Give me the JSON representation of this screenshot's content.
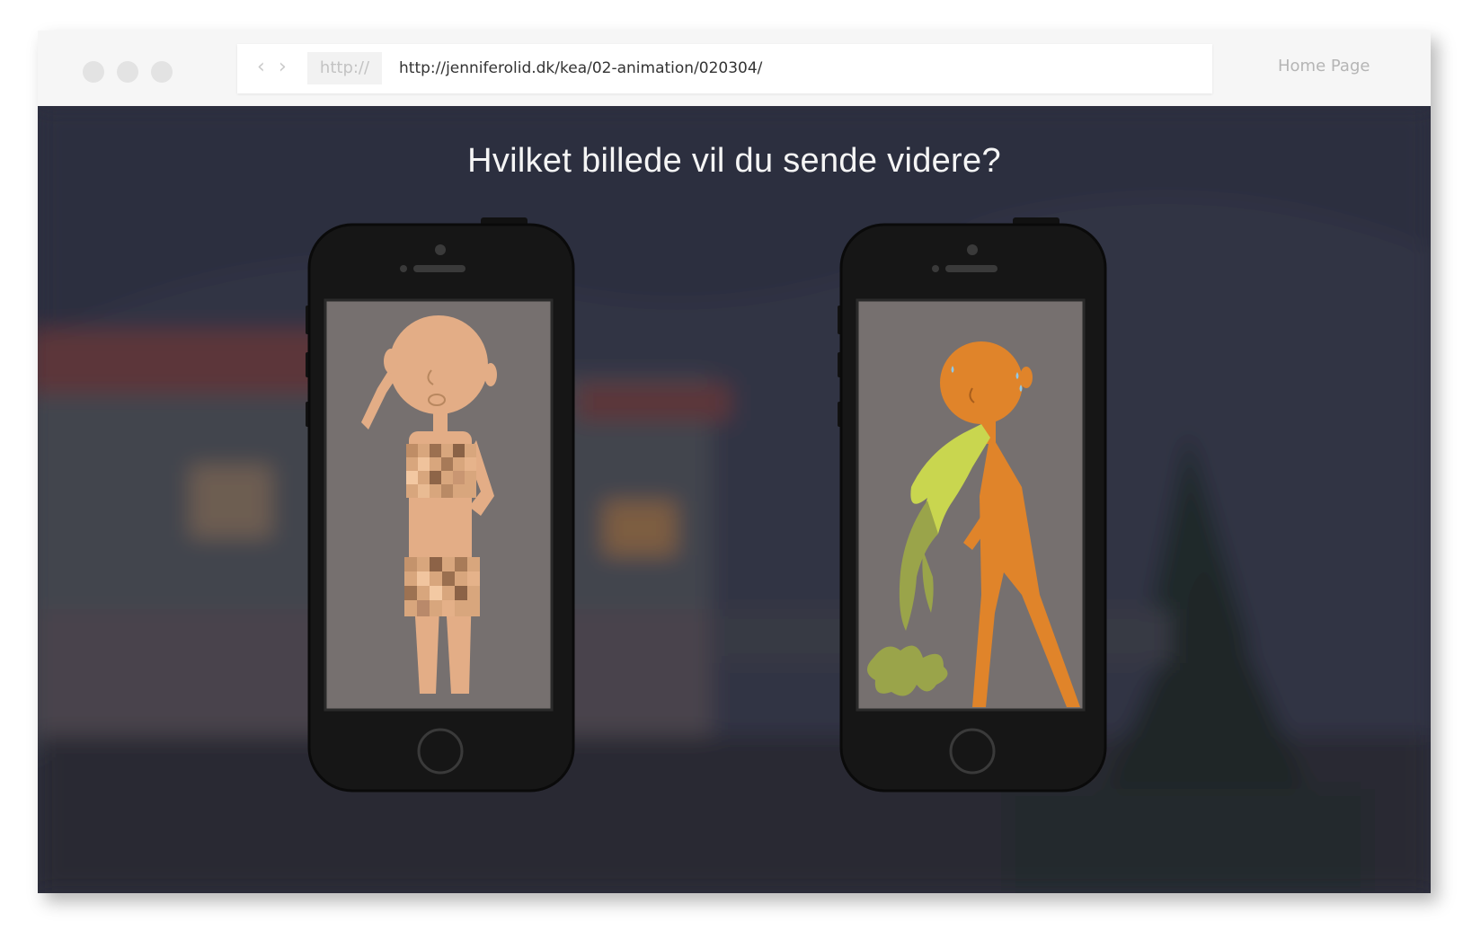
{
  "browser": {
    "protocol": "http://",
    "url": "http://jenniferolid.dk/kea/02-animation/020304/",
    "home_link": "Home Page",
    "back_icon": "chevron-left-icon",
    "forward_icon": "chevron-right-icon"
  },
  "page": {
    "question": "Hvilket billede vil du sende videre?",
    "choices": [
      {
        "id": "nude-photo",
        "figure_color": "#e3ad86",
        "censored": true
      },
      {
        "id": "vomit-photo",
        "figure_color": "#e0842a",
        "censored": false
      }
    ]
  },
  "colors": {
    "background": "#2e3141",
    "phone_body": "#161616",
    "screen": "#76706f",
    "vomit_light": "#c9d64f",
    "vomit_dark": "#9aa44a"
  }
}
